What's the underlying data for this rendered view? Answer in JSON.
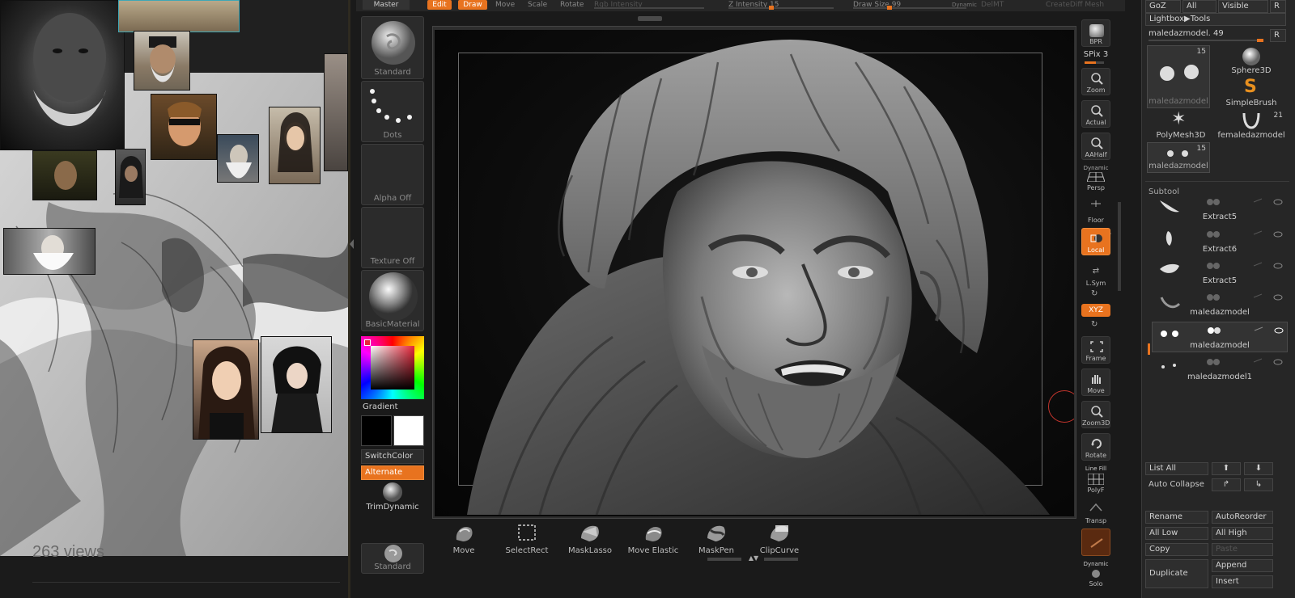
{
  "reference_board": {
    "views_text": "263 views"
  },
  "top_toolbar": {
    "master": "Master",
    "edit": "Edit",
    "draw": "Draw",
    "move": "Move",
    "scale": "Scale",
    "rotate": "Rotate",
    "rgb_intensity": "Rgb Intensity",
    "z_intensity": "Z Intensity 15",
    "draw_size": "Draw Size 99",
    "dynamic": "Dynamic",
    "del_mt": "DelMT",
    "create_diff_mesh": "CreateDiff Mesh"
  },
  "left_shelf": {
    "brush": "Standard",
    "stroke": "Dots",
    "alpha": "Alpha Off",
    "texture": "Texture Off",
    "material": "BasicMaterial",
    "gradient": "Gradient",
    "switch_color": "SwitchColor",
    "alternate": "Alternate",
    "trim_dynamic": "TrimDynamic",
    "brush_bottom": "Standard"
  },
  "bottom_palette": {
    "items": [
      {
        "label": "Move"
      },
      {
        "label": "SelectRect"
      },
      {
        "label": "MaskLasso"
      },
      {
        "label": "Move Elastic"
      },
      {
        "label": "MaskPen"
      },
      {
        "label": "ClipCurve"
      }
    ]
  },
  "right_strip": {
    "bpr": "BPR",
    "spix": "SPix 3",
    "zoom": "Zoom",
    "actual": "Actual",
    "aahalf": "AAHalf",
    "dynamic": "Dynamic",
    "persp": "Persp",
    "floor": "Floor",
    "local": "Local",
    "lsym": "L.Sym",
    "xyz": "XYZ",
    "frame": "Frame",
    "move": "Move",
    "zoom3d": "Zoom3D",
    "rotate": "Rotate",
    "line_fill": "Line Fill",
    "polyf": "PolyF",
    "transp": "Transp",
    "dynamic2": "Dynamic",
    "solo": "Solo"
  },
  "tool_panel": {
    "goz": "GoZ",
    "all": "All",
    "visible": "Visible",
    "r": "R",
    "lightbox_tools": "Lightbox▶Tools",
    "current_tool": "maledazmodel. 49",
    "tiles": [
      {
        "name": "maledazmodel",
        "count": "15"
      },
      {
        "name": "Sphere3D",
        "count": ""
      },
      {
        "name": "SimpleBrush",
        "count": ""
      },
      {
        "name": "PolyMesh3D",
        "count": ""
      },
      {
        "name": "femaledazmodel",
        "count": "21"
      },
      {
        "name": "maledazmodel",
        "count": "15"
      }
    ],
    "subtool_title": "Subtool",
    "subtools": [
      {
        "name": "Extract5"
      },
      {
        "name": "Extract6"
      },
      {
        "name": "Extract5"
      },
      {
        "name": "maledazmodel"
      },
      {
        "name": "maledazmodel"
      },
      {
        "name": "maledazmodel1"
      }
    ],
    "list_all": "List All",
    "auto_collapse": "Auto Collapse",
    "rename": "Rename",
    "auto_reorder": "AutoReorder",
    "all_low": "All Low",
    "all_high": "All High",
    "copy": "Copy",
    "paste": "Paste",
    "duplicate": "Duplicate",
    "append": "Append",
    "insert": "Insert"
  },
  "colors": {
    "accent": "#e8731f",
    "panel": "#262626",
    "canvas": "#0c0c0c"
  }
}
